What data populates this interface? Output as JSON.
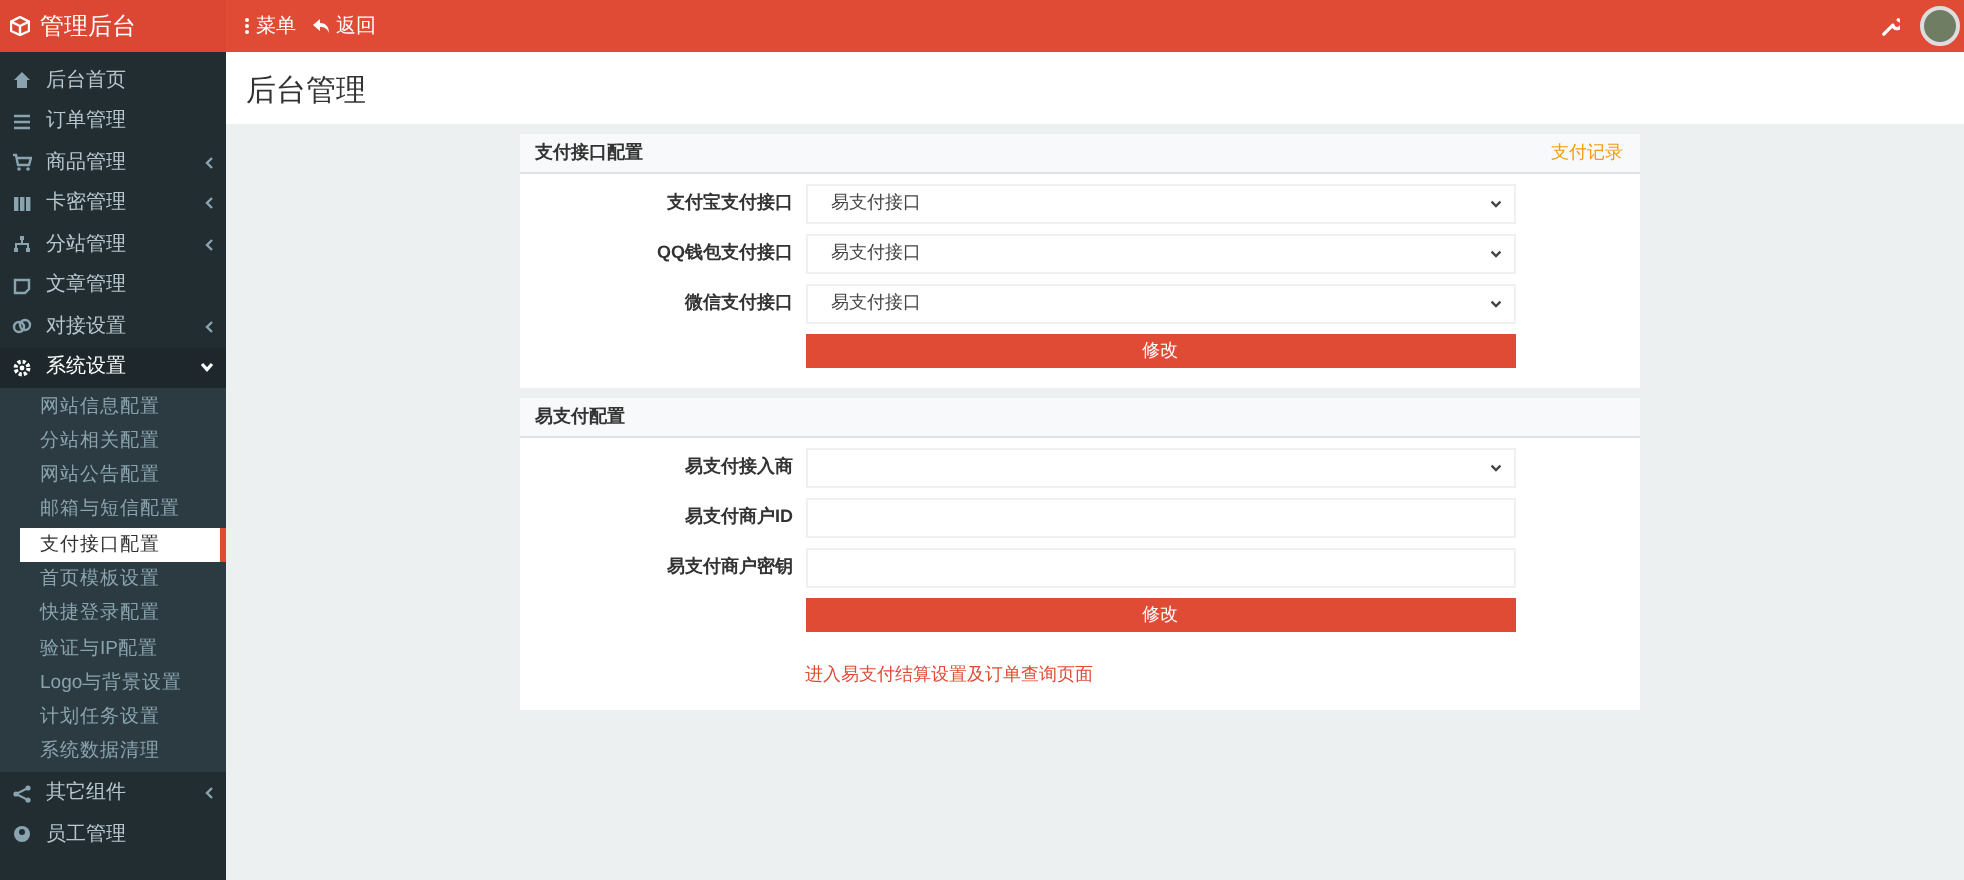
{
  "header": {
    "brand": "管理后台",
    "menu_button": "菜单",
    "back_button": "返回"
  },
  "sidebar": {
    "items": [
      {
        "label": "后台首页",
        "kind": "link"
      },
      {
        "label": "订单管理",
        "kind": "link"
      },
      {
        "label": "商品管理",
        "kind": "group",
        "expanded": false
      },
      {
        "label": "卡密管理",
        "kind": "group",
        "expanded": false
      },
      {
        "label": "分站管理",
        "kind": "group",
        "expanded": false
      },
      {
        "label": "文章管理",
        "kind": "link"
      },
      {
        "label": "对接设置",
        "kind": "group",
        "expanded": false
      },
      {
        "label": "系统设置",
        "kind": "group",
        "expanded": true,
        "children": [
          {
            "label": "网站信息配置",
            "selected": false
          },
          {
            "label": "分站相关配置",
            "selected": false
          },
          {
            "label": "网站公告配置",
            "selected": false
          },
          {
            "label": "邮箱与短信配置",
            "selected": false
          },
          {
            "label": "支付接口配置",
            "selected": true
          },
          {
            "label": "首页模板设置",
            "selected": false
          },
          {
            "label": "快捷登录配置",
            "selected": false
          },
          {
            "label": "验证与IP配置",
            "selected": false
          },
          {
            "label": "Logo与背景设置",
            "selected": false
          },
          {
            "label": "计划任务设置",
            "selected": false
          },
          {
            "label": "系统数据清理",
            "selected": false
          }
        ]
      },
      {
        "label": "其它组件",
        "kind": "group",
        "expanded": false
      },
      {
        "label": "员工管理",
        "kind": "link"
      }
    ]
  },
  "page_title": "后台管理",
  "cards": [
    {
      "title": "支付接口配置",
      "header_link": "支付记录",
      "fields": [
        {
          "label": "支付宝支付接口",
          "kind": "select",
          "value": "易支付接口"
        },
        {
          "label": "QQ钱包支付接口",
          "kind": "select",
          "value": "易支付接口"
        },
        {
          "label": "微信支付接口",
          "kind": "select",
          "value": "易支付接口"
        }
      ],
      "button": "修改"
    },
    {
      "title": "易支付配置",
      "fields": [
        {
          "label": "易支付接入商",
          "kind": "select"
        },
        {
          "label": "易支付商户ID",
          "kind": "input"
        },
        {
          "label": "易支付商户密钥",
          "kind": "input"
        }
      ],
      "button": "修改",
      "footer_link": "进入易支付结算设置及订单查询页面"
    }
  ]
}
